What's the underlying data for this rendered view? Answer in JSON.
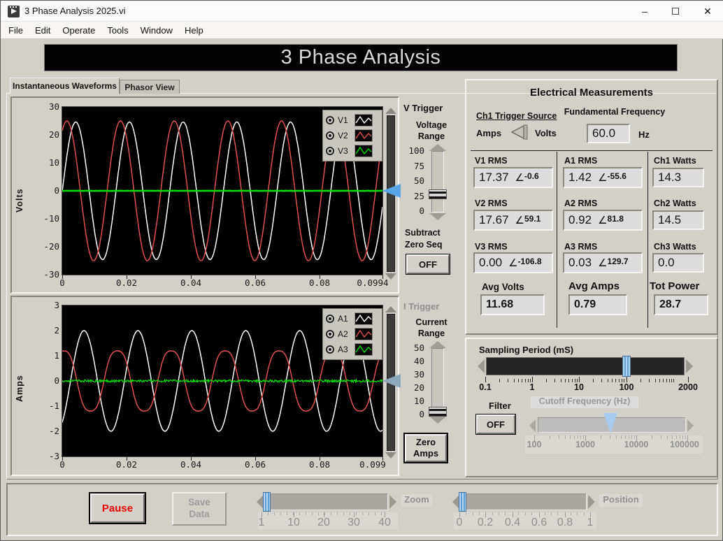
{
  "window": {
    "title": "3 Phase Analysis 2025.vi",
    "menu": [
      "File",
      "Edit",
      "Operate",
      "Tools",
      "Window",
      "Help"
    ],
    "controls": {
      "minimize": "–",
      "close": "✕"
    }
  },
  "banner": {
    "title": "3 Phase Analysis"
  },
  "tabs": [
    {
      "label": "Instantaneous Waveforms",
      "active": true
    },
    {
      "label": "Phasor View",
      "active": false
    }
  ],
  "volts_section": {
    "trigger_title": "V Trigger",
    "range_title": [
      "Voltage",
      "Range"
    ],
    "range_scale": [
      "100",
      "75",
      "50",
      "25",
      "0"
    ],
    "range_value": "28",
    "subtract_label": [
      "Subtract",
      "Zero Seq"
    ],
    "subtract_state": "OFF"
  },
  "amps_section": {
    "trigger_title": "I Trigger",
    "range_title": [
      "Current",
      "Range"
    ],
    "range_scale": [
      "50",
      "40",
      "30",
      "20",
      "10",
      "0"
    ],
    "range_value": "3",
    "zero_button": [
      "Zero",
      "Amps"
    ]
  },
  "measurements": {
    "title": "Electrical Measurements",
    "angle_symbol": "∠",
    "trigger_source": {
      "label": "Ch1 Trigger Source",
      "left": "Amps",
      "right": "Volts",
      "selected": "Volts"
    },
    "fundamental": {
      "label": "Fundamental Frequency",
      "value": "60.0",
      "unit": "Hz"
    },
    "rows": [
      {
        "v_label": "V1 RMS",
        "v": "17.37",
        "v_ang": "-0.6",
        "a_label": "A1 RMS",
        "a": "1.42",
        "a_ang": "-55.6",
        "w_label": "Ch1 Watts",
        "w": "14.3"
      },
      {
        "v_label": "V2 RMS",
        "v": "17.67",
        "v_ang": "59.1",
        "a_label": "A2 RMS",
        "a": "0.92",
        "a_ang": "81.8",
        "w_label": "Ch2 Watts",
        "w": "14.5"
      },
      {
        "v_label": "V3 RMS",
        "v": "0.00",
        "v_ang": "-106.8",
        "a_label": "A3 RMS",
        "a": "0.03",
        "a_ang": "129.7",
        "w_label": "Ch3 Watts",
        "w": "0.0"
      }
    ],
    "avg": {
      "volts_label": "Avg Volts",
      "volts": "11.68",
      "amps_label": "Avg Amps",
      "amps": "0.79",
      "power_label": "Tot Power",
      "power": "28.7"
    }
  },
  "sampling": {
    "label": "Sampling Period (mS)",
    "scale": [
      "0.1",
      "1",
      "10",
      "100",
      "2000"
    ],
    "value": "100"
  },
  "filter": {
    "label": "Filter",
    "state": "OFF"
  },
  "cutoff": {
    "label": "Cutoff Frequency (Hz)",
    "scale": [
      "100",
      "1000",
      "10000",
      "100000"
    ],
    "value": "3000",
    "enabled": false
  },
  "footer": {
    "pause": "Pause",
    "save": [
      "Save",
      "Data"
    ],
    "zoom_label": "Zoom",
    "zoom_scale": [
      "1",
      "10",
      "20",
      "30",
      "40"
    ],
    "zoom_value": "1",
    "position_label": "Position",
    "position_scale": [
      "0",
      "0.2",
      "0.4",
      "0.6",
      "0.8",
      "1"
    ],
    "position_value": "0"
  },
  "chart_data": [
    {
      "type": "line",
      "title": "",
      "xlabel": "",
      "ylabel": "Volts",
      "xlim": [
        0,
        0.0994
      ],
      "ylim": [
        -30,
        30
      ],
      "x_ticks": [
        "0",
        "0.02",
        "0.04",
        "0.06",
        "0.08",
        "0.0994"
      ],
      "y_ticks": [
        "30",
        "20",
        "10",
        "0",
        "-10",
        "-20",
        "-30"
      ],
      "grid": false,
      "legend_position": "top-right",
      "frequency_hz": 60,
      "series": [
        {
          "name": "V1",
          "color": "#ffffff",
          "rms": 17.37,
          "amplitude": 24.6,
          "phase_deg": -0.6,
          "noise": 0.05,
          "width": 1.5
        },
        {
          "name": "V2",
          "color": "#e25050",
          "rms": 17.67,
          "amplitude": 25.0,
          "phase_deg": 59.1,
          "noise": 0.05,
          "width": 1.5
        },
        {
          "name": "V3",
          "color": "#00dc00",
          "rms": 0.0,
          "amplitude": 0.0,
          "phase_deg": -106.8,
          "noise": 0.06,
          "width": 2.6
        }
      ]
    },
    {
      "type": "line",
      "title": "",
      "xlabel": "",
      "ylabel": "Amps",
      "xlim": [
        0,
        0.099
      ],
      "ylim": [
        -3,
        3
      ],
      "x_ticks": [
        "0",
        "0.02",
        "0.04",
        "0.06",
        "0.08",
        "0.099"
      ],
      "y_ticks": [
        "3",
        "2",
        "1",
        "0",
        "-1",
        "-2",
        "-3"
      ],
      "grid": false,
      "legend_position": "top-right",
      "frequency_hz": 60,
      "series": [
        {
          "name": "A1",
          "color": "#ffffff",
          "rms": 1.42,
          "amplitude": 2.0,
          "phase_deg": -55.6,
          "noise": 0,
          "width": 1.5
        },
        {
          "name": "A2",
          "color": "#e25050",
          "rms": 0.92,
          "amplitude": 1.3,
          "phase_deg": 81.8,
          "noise": 0.01,
          "width": 1.5,
          "h3": 0.08
        },
        {
          "name": "A3",
          "color": "#00dc00",
          "rms": 0.03,
          "amplitude": 0.0,
          "phase_deg": 129.7,
          "noise": 0.045,
          "width": 1.3
        }
      ]
    }
  ]
}
